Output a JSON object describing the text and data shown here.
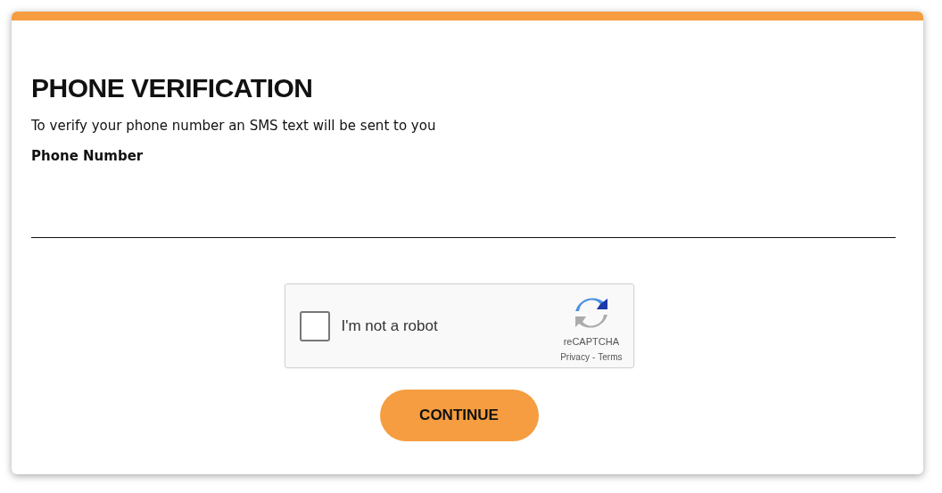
{
  "title": "PHONE VERIFICATION",
  "description": "To verify your phone number an SMS text will be sent to you",
  "phone_field": {
    "label": "Phone Number"
  },
  "captcha": {
    "checked": false,
    "label": "I'm not a robot",
    "brand": "reCAPTCHA",
    "privacy": "Privacy",
    "separator": "-",
    "terms": "Terms"
  },
  "button": "CONTINUE"
}
